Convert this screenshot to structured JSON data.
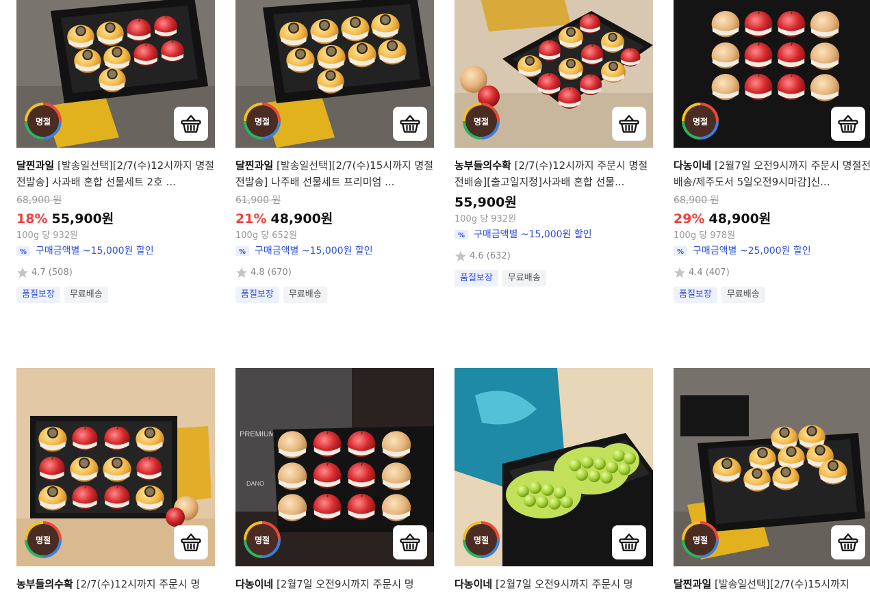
{
  "labels": {
    "badge": "명절"
  },
  "products": [
    {
      "brand": "달찐과일",
      "title": "[발송일선택][2/7(수)12시까지 명절전발송] 사과배 혼합 선물세트 2호 ...",
      "original_price": "68,900 원",
      "discount_rate": "18%",
      "price": "55,900원",
      "unit_price": "100g 당 932원",
      "coupon": "구매금액별 ~15,000원 할인",
      "rating": "4.7 (508)",
      "tags": [
        "품질보장",
        "무료배송"
      ]
    },
    {
      "brand": "달찐과일",
      "title": "[발송일선택][2/7(수)15시까지 명절전발송] 나주배 선물세트 프리미엄 ...",
      "original_price": "61,900 원",
      "discount_rate": "21%",
      "price": "48,900원",
      "unit_price": "100g 당 652원",
      "coupon": "구매금액별 ~15,000원 할인",
      "rating": "4.8 (670)",
      "tags": [
        "품질보장",
        "무료배송"
      ]
    },
    {
      "brand": "농부들의수확",
      "title": "[2/7(수)12시까지 주문시 명절전배송][출고일지정]사과배 혼합 선물...",
      "original_price": "",
      "discount_rate": "",
      "price": "55,900원",
      "unit_price": "100g 당 932원",
      "coupon": "구매금액별 ~15,000원 할인",
      "rating": "4.6 (632)",
      "tags": [
        "품질보장",
        "무료배송"
      ]
    },
    {
      "brand": "다농이네",
      "title": "[2월7일 오전9시까지 주문시 명절전배송/제주도서 5일오전9시마감]신...",
      "original_price": "68,900 원",
      "discount_rate": "29%",
      "price": "48,900원",
      "unit_price": "100g 당 978원",
      "coupon": "구매금액별 ~25,000원 할인",
      "rating": "4.4 (407)",
      "tags": [
        "품질보장",
        "무료배송"
      ]
    },
    {
      "brand": "농부들의수확",
      "title": "[2/7(수)12시까지 주문시 명"
    },
    {
      "brand": "다농이네",
      "title": "[2월7일 오전9시까지 주문시 명"
    },
    {
      "brand": "다농이네",
      "title": "[2월7일 오전9시까지 주문시 명"
    },
    {
      "brand": "달찐과일",
      "title": "[발송일선택][2/7(수)15시까지"
    }
  ],
  "photo_text": {
    "box_brand_1": "PREMIUM",
    "box_brand_2": "DANO"
  },
  "icons": {
    "cart": "basket-icon",
    "star": "star-icon",
    "coupon": "coupon-icon"
  },
  "colors": {
    "discount": "#f0403c",
    "coupon": "#2d4fd8",
    "badge_bg": "#4a2c22"
  }
}
